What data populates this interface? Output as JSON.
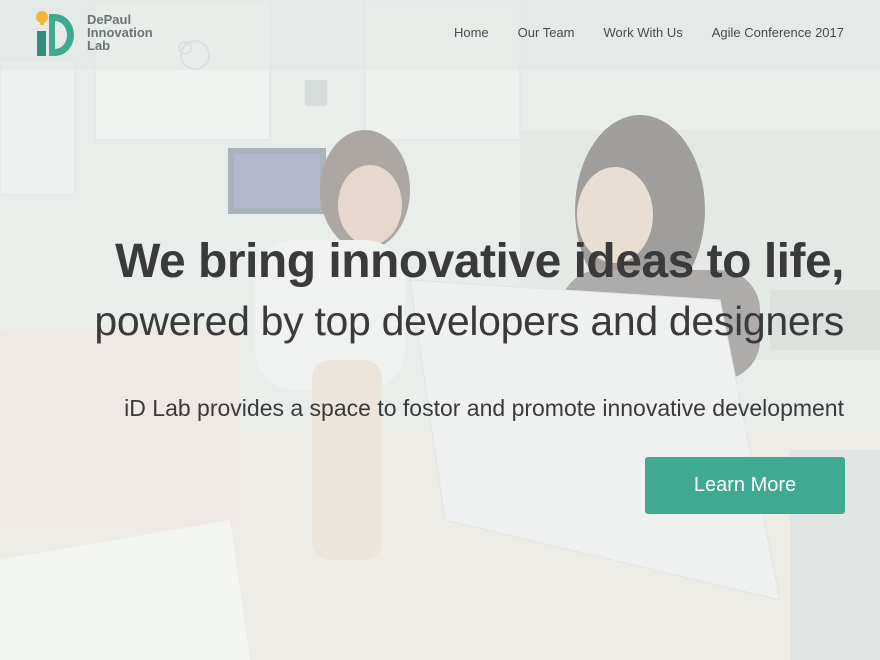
{
  "brand": {
    "name_line1": "DePaul",
    "name_line2": "Innovation",
    "name_line3": "Lab",
    "logo_icon": "id-lightbulb-logo",
    "colors": {
      "teal": "#3fa992",
      "yellow": "#f2b733"
    }
  },
  "nav": {
    "items": [
      {
        "label": "Home"
      },
      {
        "label": "Our Team"
      },
      {
        "label": "Work With Us"
      },
      {
        "label": "Agile Conference 2017"
      }
    ]
  },
  "hero": {
    "headline": "We bring innovative ideas to life,",
    "subheadline": "powered by top developers and designers",
    "tagline": "iD Lab provides a space to fostor and promote innovative development",
    "cta_label": "Learn More",
    "cta_color": "#3fa992"
  }
}
